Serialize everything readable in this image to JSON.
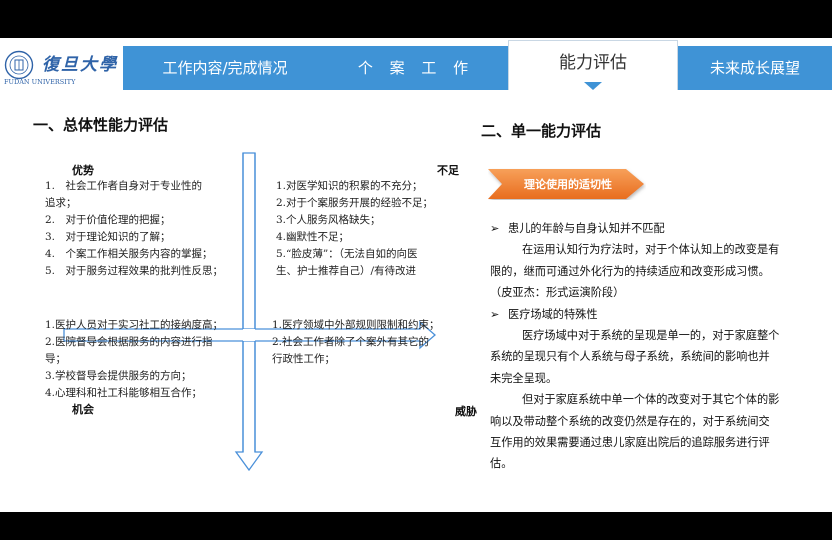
{
  "header": {
    "logo_cn": "復旦大學",
    "logo_en": "FUDAN UNIVERSITY",
    "tabs": [
      {
        "label": "工作内容/完成情况"
      },
      {
        "label": "个 案 工 作"
      },
      {
        "label": "能力评估"
      },
      {
        "label": "未来成长展望"
      }
    ],
    "active_tab": "能力评估",
    "accent_color": "#3f93d6"
  },
  "left": {
    "title": "一、总体性能力评估",
    "strengths": {
      "label": "优势",
      "items": [
        "1.　社会工作者自身对于专业性的",
        "追求；",
        "2.　对于价值伦理的把握；",
        "3.　对于理论知识的了解；",
        "4.　个案工作相关服务内容的掌握；",
        "5.　对于服务过程效果的批判性反思；"
      ]
    },
    "weaknesses": {
      "label": "不足",
      "items": [
        "1.对医学知识的积累的不充分；",
        "2.对于个案服务开展的经验不足；",
        "3.个人服务风格缺失；",
        "4.幽默性不足；",
        "5.“脸皮薄”：（无法自如的向医",
        "生、护士推荐自己）/有待改进"
      ]
    },
    "opportunities": {
      "label": "机会",
      "items": [
        "1.医护人员对于实习社工的接纳度高；",
        "2.医院督导会根据服务的内容进行指",
        "导；",
        "3.学校督导会提供服务的方向；",
        "4.心理科和社工科能够相互合作；"
      ]
    },
    "threats": {
      "label": "威胁",
      "items": [
        "1.医疗领域中外部规则限制和约束；",
        "2.社会工作者除了个案外有其它的",
        "行政性工作；"
      ]
    }
  },
  "right": {
    "title": "二、单一能力评估",
    "tag": "理论使用的适切性",
    "lines": [
      {
        "kind": "bullet",
        "text": "患儿的年龄与自身认知并不匹配"
      },
      {
        "kind": "indent",
        "text": "在运用认知行为疗法时，对于个体认知上的改变是有"
      },
      {
        "kind": "plain",
        "text": "限的，继而可通过外化行为的持续适应和改变形成习惯。"
      },
      {
        "kind": "plain",
        "text": "（皮亚杰：形式运演阶段）"
      },
      {
        "kind": "bullet",
        "text": "医疗场域的特殊性"
      },
      {
        "kind": "indent",
        "text": "医疗场域中对于系统的呈现是单一的，对于家庭整个"
      },
      {
        "kind": "plain",
        "text": "系统的呈现只有个人系统与母子系统，系统间的影响也并"
      },
      {
        "kind": "plain",
        "text": "未完全呈现。"
      },
      {
        "kind": "indent",
        "text": "但对于家庭系统中单一个体的改变对于其它个体的影"
      },
      {
        "kind": "plain",
        "text": "响以及带动整个系统的改变仍然是存在的，对于系统间交"
      },
      {
        "kind": "plain",
        "text": "互作用的效果需要通过患儿家庭出院后的追踪服务进行评"
      },
      {
        "kind": "plain",
        "text": "估。"
      }
    ]
  }
}
